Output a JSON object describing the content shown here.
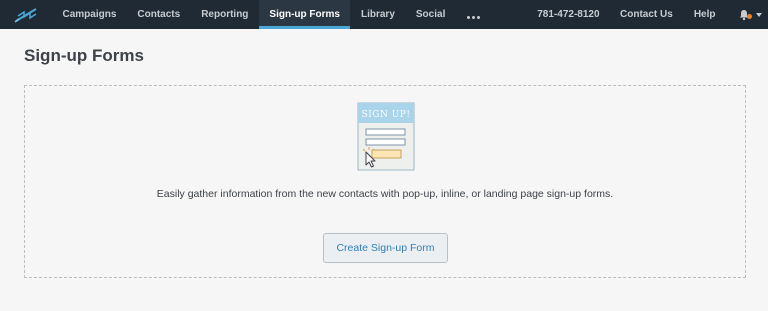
{
  "nav": {
    "items": [
      {
        "label": "Campaigns",
        "active": false
      },
      {
        "label": "Contacts",
        "active": false
      },
      {
        "label": "Reporting",
        "active": false
      },
      {
        "label": "Sign-up Forms",
        "active": true
      },
      {
        "label": "Library",
        "active": false
      },
      {
        "label": "Social",
        "active": false
      }
    ],
    "more_icon": "more-dots-icon",
    "phone": "781-472-8120",
    "contact_us": "Contact Us",
    "help": "Help",
    "notifications_icon": "bell-icon",
    "account_menu_icon": "chevron-down-icon"
  },
  "page": {
    "title": "Sign-up Forms"
  },
  "empty_state": {
    "illustration_text": "SIGN UP!",
    "description": "Easily gather information from the new contacts with pop-up, inline, or landing page sign-up forms.",
    "create_button_label": "Create Sign-up Form"
  },
  "colors": {
    "nav_background": "#1f2a35",
    "active_underline": "#4aa8d6",
    "link_blue": "#2f7fb5",
    "badge_orange": "#f5821f"
  }
}
